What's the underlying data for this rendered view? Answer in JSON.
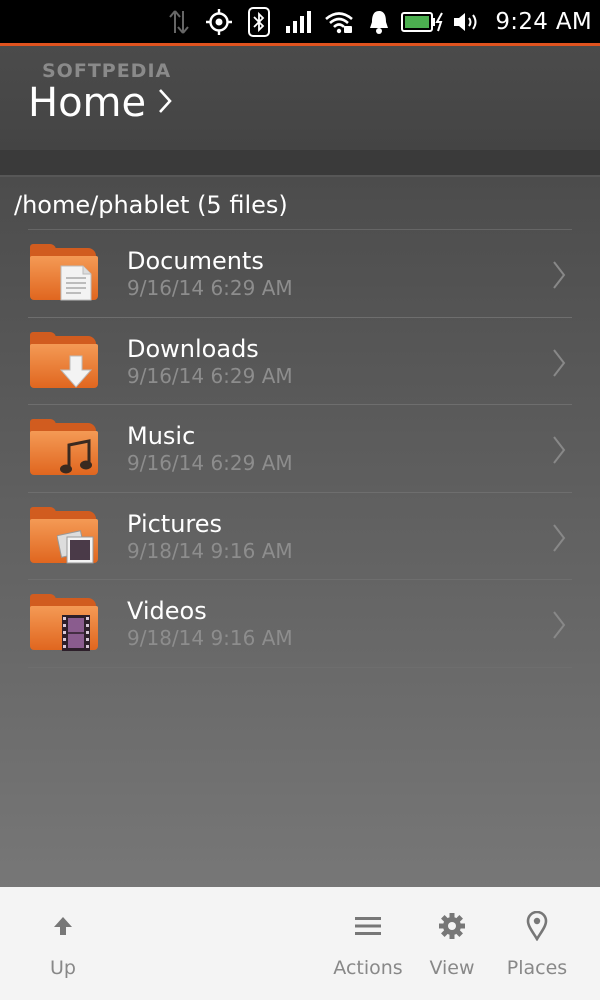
{
  "status_bar": {
    "time": "9:24 AM",
    "icons": [
      "data-transfer-icon",
      "gps-icon",
      "bluetooth-icon",
      "cellular-signal-icon",
      "wifi-icon",
      "notification-bell-icon",
      "battery-charging-icon",
      "volume-icon"
    ]
  },
  "header": {
    "watermark": "SOFTPEDIA",
    "title": "Home",
    "title_icon": "chevron-right-icon"
  },
  "content": {
    "path": "/home/phablet (5 files)",
    "files": [
      {
        "name": "Documents",
        "date": "9/16/14 6:29 AM",
        "icon": "folder-documents-icon"
      },
      {
        "name": "Downloads",
        "date": "9/16/14 6:29 AM",
        "icon": "folder-downloads-icon"
      },
      {
        "name": "Music",
        "date": "9/16/14 6:29 AM",
        "icon": "folder-music-icon"
      },
      {
        "name": "Pictures",
        "date": "9/18/14 9:16 AM",
        "icon": "folder-pictures-icon"
      },
      {
        "name": "Videos",
        "date": "9/18/14 9:16 AM",
        "icon": "folder-videos-icon"
      }
    ]
  },
  "toolbar": {
    "up_label": "Up",
    "actions_label": "Actions",
    "view_label": "View",
    "places_label": "Places"
  },
  "colors": {
    "accent": "#e0531f",
    "folder": "#e0661f",
    "toolbar_bg": "#f4f4f4"
  }
}
